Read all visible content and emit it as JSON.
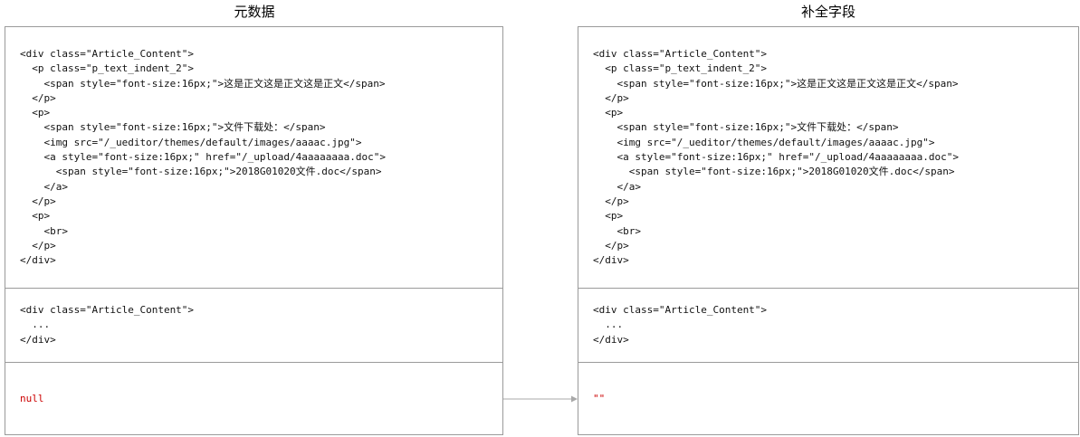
{
  "left_panel": {
    "title": "元数据",
    "sections": [
      "<div class=\"Article_Content\">\n  <p class=\"p_text_indent_2\">\n    <span style=\"font-size:16px;\">这是正文这是正文这是正文</span>\n  </p>\n  <p>\n    <span style=\"font-size:16px;\">文件下载处：</span>\n    <img src=\"/_ueditor/themes/default/images/aaaac.jpg\">\n    <a style=\"font-size:16px;\" href=\"/_upload/4aaaaaaaa.doc\">\n      <span style=\"font-size:16px;\">2018G01020文件.doc</span>\n    </a>\n  </p>\n  <p>\n    <br>\n  </p>\n</div>",
      "<div class=\"Article_Content\">\n  ...\n</div>",
      "null"
    ]
  },
  "right_panel": {
    "title": "补全字段",
    "sections": [
      "<div class=\"Article_Content\">\n  <p class=\"p_text_indent_2\">\n    <span style=\"font-size:16px;\">这是正文这是正文这是正文</span>\n  </p>\n  <p>\n    <span style=\"font-size:16px;\">文件下载处：</span>\n    <img src=\"/_ueditor/themes/default/images/aaaac.jpg\">\n    <a style=\"font-size:16px;\" href=\"/_upload/4aaaaaaaa.doc\">\n      <span style=\"font-size:16px;\">2018G01020文件.doc</span>\n    </a>\n  </p>\n  <p>\n    <br>\n  </p>\n</div>",
      "<div class=\"Article_Content\">\n  ...\n</div>",
      "\"\""
    ]
  },
  "colors": {
    "border": "#9a9a9a",
    "null_text": "#cc0000",
    "arrow": "#a8a8a8"
  }
}
